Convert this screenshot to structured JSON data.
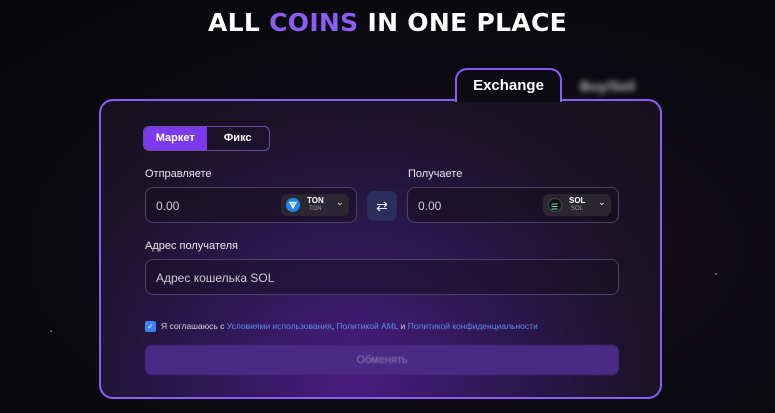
{
  "headline": {
    "part1": "ALL ",
    "accent": "COINS",
    "part2": " IN ONE PLACE"
  },
  "tabs": {
    "exchange": "Exchange",
    "buysell": "Buy/Sell"
  },
  "mode": {
    "market": "Маркет",
    "fixed": "Фикс"
  },
  "send": {
    "label": "Отправляете",
    "value": "0.00",
    "coin": "TON",
    "network": "TON"
  },
  "receive": {
    "label": "Получаете",
    "value": "0.00",
    "coin": "SOL",
    "network": "SOL"
  },
  "swap_icon": "swap-arrows-icon",
  "address": {
    "label": "Адрес получателя",
    "placeholder": "Адрес кошелька SOL"
  },
  "agreement": {
    "prefix": "Я соглашаюсь с ",
    "link1": "Условиями использования",
    "sep1": ", ",
    "link2": "Политикой AML",
    "sep2": " и ",
    "link3": "Политикой конфиденциальности"
  },
  "submit_label": "Обменять",
  "colors": {
    "accent": "#8b5cf6",
    "link": "#5b8def",
    "ton": "#1e88e5",
    "sol": "#111111"
  }
}
